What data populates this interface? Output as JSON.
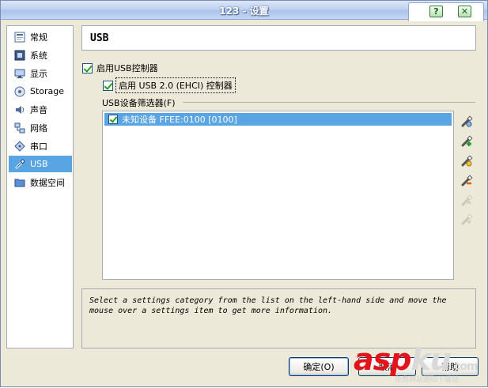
{
  "window": {
    "title": "123 - 设置",
    "help_glyph": "?",
    "close_glyph": "✕"
  },
  "sidebar": {
    "items": [
      {
        "label": "常规",
        "icon": "general-icon"
      },
      {
        "label": "系统",
        "icon": "system-icon"
      },
      {
        "label": "显示",
        "icon": "display-icon"
      },
      {
        "label": "Storage",
        "icon": "storage-icon"
      },
      {
        "label": "声音",
        "icon": "audio-icon"
      },
      {
        "label": "网络",
        "icon": "network-icon"
      },
      {
        "label": "串口",
        "icon": "serial-port-icon"
      },
      {
        "label": "USB",
        "icon": "usb-icon",
        "selected": true
      },
      {
        "label": "数据空间",
        "icon": "shared-folder-icon"
      }
    ]
  },
  "page": {
    "title": "USB"
  },
  "usb": {
    "enable_controller_label": "启用USB控制器",
    "enable_controller_checked": true,
    "enable_ehci_label": "启用 USB 2.0 (EHCI) 控制器",
    "enable_ehci_checked": true,
    "filters_label": "USB设备筛选器(F)",
    "filters": [
      {
        "label": "未知设备 FFEE:0100 [0100]",
        "checked": true,
        "selected": true
      }
    ],
    "toolbar": [
      {
        "name": "add-empty-filter",
        "enabled": true
      },
      {
        "name": "add-filter-from-device",
        "enabled": true
      },
      {
        "name": "edit-filter",
        "enabled": true
      },
      {
        "name": "remove-filter",
        "enabled": true
      },
      {
        "name": "move-filter-up",
        "enabled": false
      },
      {
        "name": "move-filter-down",
        "enabled": false
      }
    ]
  },
  "info": {
    "text": "Select a settings category from the list on the left-hand side and move the mouse over a settings item to get more information."
  },
  "buttons": {
    "ok": "确定(O)",
    "cancel": "取消",
    "help": "帮助"
  },
  "watermark": {
    "logo_asp": "asp",
    "logo_ku": "ku",
    "logo_tld": ".com",
    "subtitle": "免费网站源码下载站"
  },
  "colors": {
    "selection": "#59a4e2",
    "window_bg": "#ece9d8",
    "check_green": "#21a121"
  }
}
